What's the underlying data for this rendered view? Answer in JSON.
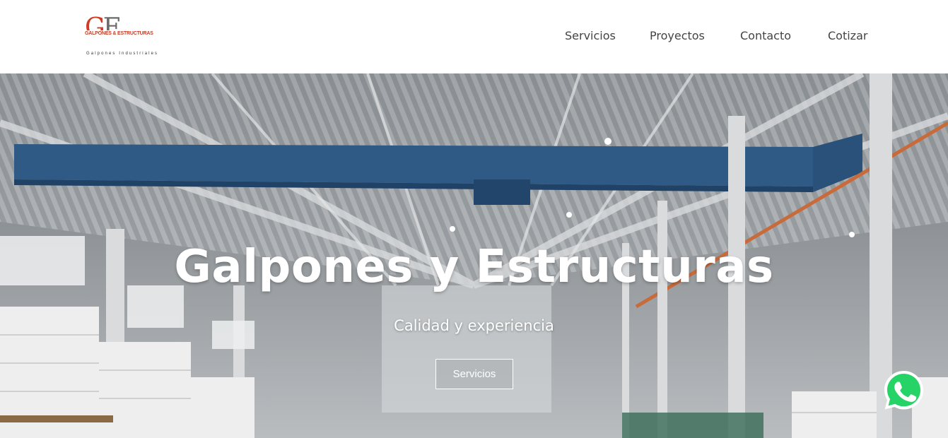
{
  "logo": {
    "letter_g": "G",
    "letter_e": "E",
    "name": "GALPONES & ESTRUCTURAS",
    "tagline": "Galpones Industriales"
  },
  "nav": {
    "items": [
      {
        "label": "Servicios"
      },
      {
        "label": "Proyectos"
      },
      {
        "label": "Contacto"
      },
      {
        "label": "Cotizar"
      }
    ]
  },
  "hero": {
    "title": "Galpones y Estructuras",
    "subtitle": "Calidad y experiencia",
    "button_label": "Servicios",
    "background": "industrial-warehouse-photo"
  },
  "whatsapp": {
    "icon": "whatsapp-icon",
    "color": "#25d366"
  },
  "colors": {
    "brand_red": "#d13b22",
    "brand_gray": "#6a6a6a",
    "nav_text": "#444444"
  }
}
